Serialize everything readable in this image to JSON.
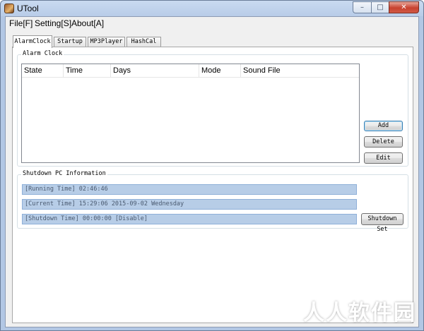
{
  "window": {
    "title": "UTool",
    "caption_buttons": {
      "minimize": "–",
      "maximize": "□",
      "close": "✕"
    }
  },
  "menu": [
    "File[F]",
    "Setting[S]",
    "About[A]"
  ],
  "tabs": [
    "AlarmClock",
    "Startup",
    "MP3Player",
    "HashCal"
  ],
  "active_tab": "AlarmClock",
  "alarm_group": {
    "title": "Alarm Clock",
    "columns": [
      "State",
      "Time",
      "Days",
      "Mode",
      "Sound File"
    ],
    "rows": [],
    "buttons": {
      "add": "Add",
      "delete": "Delete",
      "edit": "Edit"
    }
  },
  "shutdown_group": {
    "title": "Shutdown PC Information",
    "running_time": "[Running Time] 02:46:46",
    "current_time": "[Current Time] 15:29:06 2015-09-02 Wednesday",
    "shutdown_time": "[Shutdown Time] 00:00:00 [Disable]",
    "shutdown_button": "Shutdown Set"
  },
  "watermark": "人人软件园",
  "colors": {
    "title_bar": "#b9cde8",
    "info_field": "#b7cde7",
    "close_button": "#c8412f"
  }
}
